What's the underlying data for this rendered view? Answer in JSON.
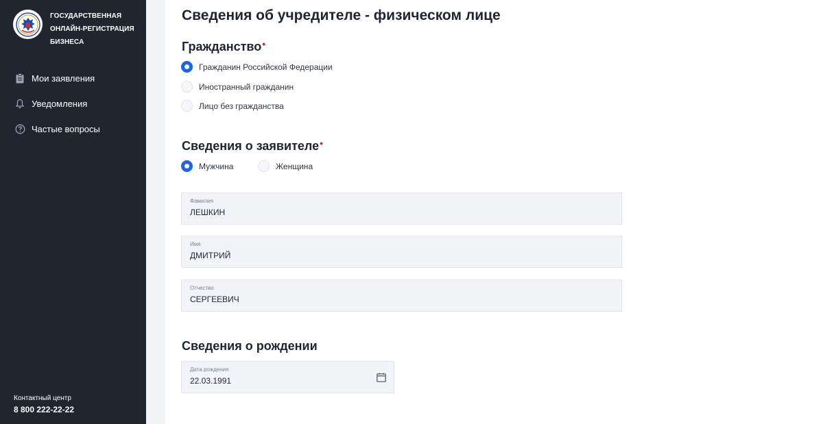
{
  "sidebar": {
    "brand": {
      "line1": "Государственная",
      "line2": "онлайн-регистрация",
      "line3": "бизнеса",
      "emblem_icon": "coat-of-arms-icon"
    },
    "nav": [
      {
        "label": "Мои заявления",
        "icon": "clipboard-icon"
      },
      {
        "label": "Уведомления",
        "icon": "bell-icon"
      },
      {
        "label": "Частые вопросы",
        "icon": "question-circle-icon"
      }
    ],
    "contact": {
      "label": "Контактный центр",
      "phone": "8 800 222-22-22"
    }
  },
  "main": {
    "title": "Сведения об учредителе - физическом лице",
    "citizenship": {
      "title": "Гражданство",
      "required": "•",
      "options": [
        {
          "label": "Гражданин Российской Федерации",
          "checked": true
        },
        {
          "label": "Иностранный гражданин",
          "checked": false
        },
        {
          "label": "Лицо без гражданства",
          "checked": false
        }
      ]
    },
    "applicant": {
      "title": "Сведения о заявителе",
      "required": "•",
      "gender": [
        {
          "label": "Мужчина",
          "checked": true
        },
        {
          "label": "Женщина",
          "checked": false
        }
      ],
      "surname": {
        "label": "Фамилия",
        "value": "ЛЕШКИН"
      },
      "name": {
        "label": "Имя",
        "value": "ДМИТРИЙ"
      },
      "patronymic": {
        "label": "Отчество",
        "value": "СЕРГЕЕВИЧ"
      }
    },
    "birth": {
      "title": "Сведения о рождении",
      "date": {
        "label": "Дата рождения",
        "value": "22.03.1991",
        "icon": "calendar-icon"
      }
    }
  },
  "colors": {
    "sidebar_bg": "#202530",
    "accent": "#1e63e9",
    "required": "#e0242e",
    "field_bg": "#f2f4f8"
  }
}
